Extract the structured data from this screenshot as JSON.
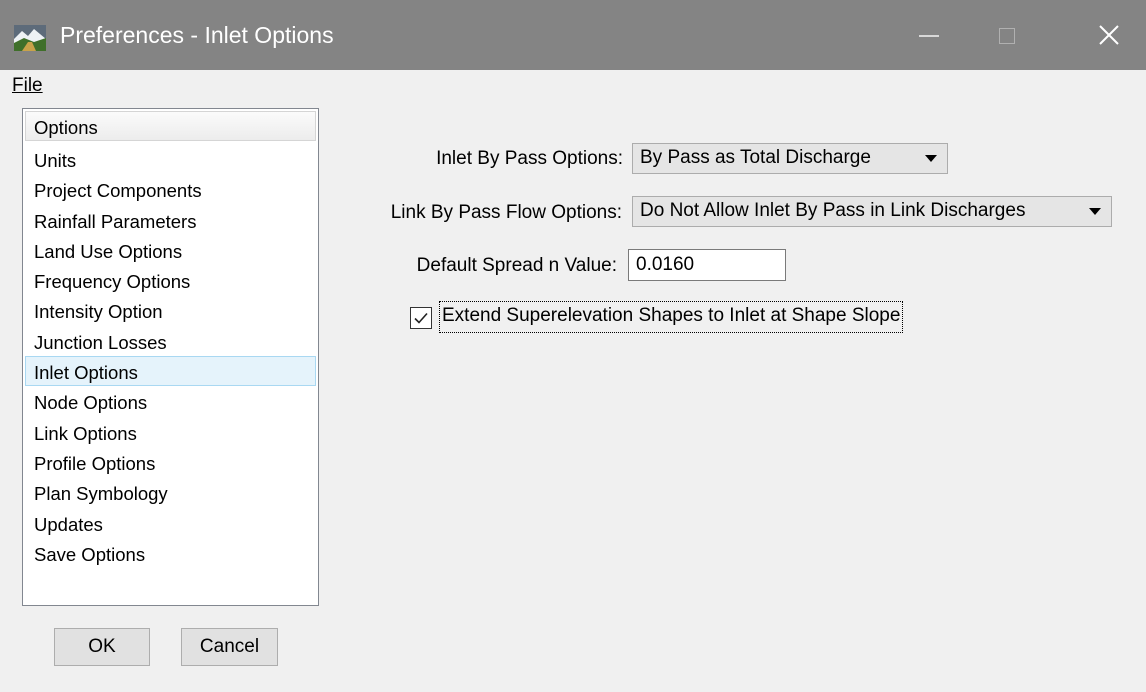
{
  "window": {
    "title": "Preferences - Inlet Options",
    "icon": "landscape-app-icon",
    "controls": [
      "minimize-icon",
      "maximize-icon",
      "close-icon"
    ]
  },
  "menu": {
    "file": "File"
  },
  "options": {
    "header": "Options",
    "items": [
      "Units",
      "Project Components",
      "Rainfall Parameters",
      "Land Use Options",
      "Frequency Options",
      "Intensity Option",
      "Junction Losses",
      "Inlet Options",
      "Node Options",
      "Link Options",
      "Profile Options",
      "Plan Symbology",
      "Updates",
      "Save Options"
    ],
    "selected": "Inlet Options"
  },
  "form": {
    "inlet_bypass_label": "Inlet By Pass Options:",
    "inlet_bypass_value": "By Pass as Total Discharge",
    "link_bypass_label": "Link By Pass Flow Options:",
    "link_bypass_value": "Do Not Allow Inlet By Pass in Link Discharges",
    "spread_label": "Default Spread n Value:",
    "spread_value": "0.0160",
    "superelevation_label": "Extend Superelevation Shapes to Inlet at Shape Slope",
    "superelevation_checked": true
  },
  "buttons": {
    "ok": "OK",
    "cancel": "Cancel"
  },
  "colors": {
    "titlebar": "#848484",
    "selection_bg": "#e5f3fb",
    "selection_border": "#a9d8f2"
  }
}
